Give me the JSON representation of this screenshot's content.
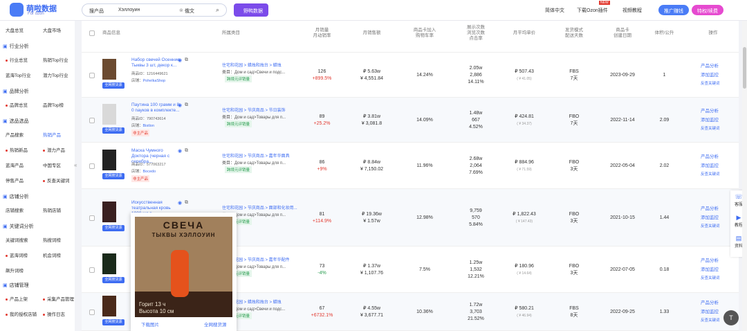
{
  "header": {
    "logo_text": "萌啦数据",
    "logo_sub": "For ozon",
    "search_select": "搜产品",
    "search_query": "Хэллоуин",
    "lang": "俄文",
    "badge": "野鸭数据",
    "links": [
      "简体中文",
      "下载Ozon插件",
      "视频教程"
    ],
    "new_badge": "NEW",
    "promo": "推广赚钱",
    "vip": "特权/续费"
  },
  "sidebar": {
    "items": [
      {
        "label": "大盘总览",
        "kind": "item",
        "dot": false
      },
      {
        "label": "大盘市场",
        "kind": "item",
        "dot": false
      },
      {
        "label": "行业分析",
        "kind": "section",
        "dot": false
      },
      {
        "label": "行业总览",
        "kind": "item",
        "dot": true
      },
      {
        "label": "热销Top行业",
        "kind": "item",
        "dot": false
      },
      {
        "label": "蓝海Top行业",
        "kind": "item",
        "dot": false
      },
      {
        "label": "潜力Top行业",
        "kind": "item",
        "dot": false
      },
      {
        "label": "品牌分析",
        "kind": "section",
        "dot": false
      },
      {
        "label": "品牌总览",
        "kind": "item",
        "dot": true
      },
      {
        "label": "品牌Top榜",
        "kind": "item",
        "dot": false
      },
      {
        "label": "选品选品",
        "kind": "section",
        "dot": false
      },
      {
        "label": "产品搜索",
        "kind": "item",
        "dot": false
      },
      {
        "label": "热销产品",
        "kind": "item",
        "dot": false
      },
      {
        "label": "热销新品",
        "kind": "item",
        "dot": true
      },
      {
        "label": "潜力产品",
        "kind": "item",
        "dot": true
      },
      {
        "label": "蓝海产品",
        "kind": "item",
        "dot": false
      },
      {
        "label": "中国专区",
        "kind": "item",
        "dot": false
      },
      {
        "label": "停售产品",
        "kind": "item",
        "dot": false
      },
      {
        "label": "反查关键词",
        "kind": "item",
        "dot": true
      },
      {
        "label": "店铺分析",
        "kind": "section",
        "dot": false
      },
      {
        "label": "店铺搜索",
        "kind": "item",
        "dot": false
      },
      {
        "label": "热销店铺",
        "kind": "item",
        "dot": false
      },
      {
        "label": "关键词分析",
        "kind": "section",
        "dot": false
      },
      {
        "label": "关键词搜索",
        "kind": "item",
        "dot": false
      },
      {
        "label": "热搜词榜",
        "kind": "item",
        "dot": false
      },
      {
        "label": "蓝海词榜",
        "kind": "item",
        "dot": true
      },
      {
        "label": "机会词榜",
        "kind": "item",
        "dot": false
      },
      {
        "label": "飙升词榜",
        "kind": "item",
        "dot": false
      },
      {
        "label": "店铺管理",
        "kind": "section",
        "dot": false
      },
      {
        "label": "产品上架",
        "kind": "item",
        "dot": true
      },
      {
        "label": "采集产品管理",
        "kind": "item",
        "dot": true
      },
      {
        "label": "我的授权店铺",
        "kind": "item",
        "dot": true
      },
      {
        "label": "操作日志",
        "kind": "item",
        "dot": true
      }
    ]
  },
  "table": {
    "headers": [
      "商品信息",
      "所属类目",
      "月销量\n月动销率",
      "月销售额",
      "商品卡加入\n购物车率",
      "展示次数\n浏览次数\n点击率",
      "月平均单价",
      "发货模式\n配送天数",
      "商品卡\n创建日期",
      "体积/公升",
      "操作"
    ],
    "rows": [
      {
        "title": "Набор свечей Осенние Тыквы 3 шт, декор к...",
        "id": "商品ID：1216449621",
        "shop_label": "店铺：",
        "shop": "PohelkaShop",
        "private": "",
        "cat1": "住宅和花园 > 蜡烛和烛台 > 蜡烛",
        "cat2": "类目：Дом и сад>Свечи и подс...",
        "tag": "跨境元评销量",
        "sales": "126",
        "sales_rate": "+899.5%",
        "rate_dir": "up",
        "rev1": "₽ 5.63w",
        "rev2": "¥ 4,551.84",
        "cart": "14.24%",
        "views": "2.05w",
        "clicks": "2,886",
        "ctr": "14.11%",
        "price": "₽ 507.43",
        "price2": "( ¥ 41.05)",
        "ship": "FBS",
        "days": "7天",
        "date": "2023-09-29",
        "vol": "1"
      },
      {
        "title": "Паутина 100 грамм и 8 0 пауков в комплекте...",
        "id": "商品ID：790743614",
        "shop_label": "店铺：",
        "shop": "Bistlon",
        "private": "非主产品",
        "cat1": "住宅和花园 > 节庆商品 > 节日装饰",
        "cat2": "类目：Дом и сад>Товары для п...",
        "tag": "跨境元评销量",
        "sales": "89",
        "sales_rate": "+25.2%",
        "rate_dir": "up",
        "rev1": "₽ 3.81w",
        "rev2": "¥ 3,081.8",
        "cart": "14.09%",
        "views": "1.48w",
        "clicks": "667",
        "ctr": "4.52%",
        "price": "₽ 424.81",
        "price2": "( ¥ 34.37)",
        "ship": "FBO",
        "days": "7天",
        "date": "2022-11-14",
        "vol": "2.09"
      },
      {
        "title": "Маска Чумного Доктора (черная с серебра...",
        "id": "商品ID：577063217",
        "shop_label": "店铺：",
        "shop": "Bocedo",
        "private": "非主产品",
        "cat1": "住宅和花园 > 节庆商品 > 嘉年华面具",
        "cat2": "类目：Дом и сад>Товары для п...",
        "tag": "跨境元评销量",
        "sales": "86",
        "sales_rate": "+9%",
        "rate_dir": "up",
        "rev1": "₽ 8.84w",
        "rev2": "¥ 7,150.02",
        "cart": "11.96%",
        "views": "2.68w",
        "clicks": "2,064",
        "ctr": "7.69%",
        "price": "₽ 884.96",
        "price2": "( ¥ 71.59)",
        "ship": "FBO",
        "days": "3天",
        "date": "2022-05-04",
        "vol": "2.02"
      },
      {
        "title": "Искусственная театральная кровь 1000 мл в...",
        "id": "商品ID：257488474",
        "shop_label": "店铺：",
        "shop": "",
        "private": "",
        "cat1": "住宅和花园 > 节庆商品 > 面部和化妆用...",
        "cat2": "类目：Дом и сад>Товары для п...",
        "tag": "跨境元评销量",
        "sales": "81",
        "sales_rate": "+114.9%",
        "rate_dir": "up",
        "rev1": "₽ 19.36w",
        "rev2": "¥ 1.57w",
        "cart": "12.98%",
        "views": "9,759",
        "clicks": "570",
        "ctr": "5.84%",
        "price": "₽ 1,822.43",
        "price2": "( ¥ 147.43)",
        "ship": "FBO",
        "days": "3天",
        "date": "2021-10-15",
        "vol": "1.44"
      },
      {
        "title": "",
        "id": "",
        "shop_label": "",
        "shop": "",
        "private": "",
        "cat1": "住宅和花园 > 节庆商品 > 嘉年华配件",
        "cat2": "类目：Дом и сад>Товары для п...",
        "tag": "跨境元评销量",
        "sales": "73",
        "sales_rate": "-4%",
        "rate_dir": "down",
        "rev1": "₽ 1.37w",
        "rev2": "¥ 1,107.76",
        "cart": "7.5%",
        "views": "1.25w",
        "clicks": "1,532",
        "ctr": "12.21%",
        "price": "₽ 180.96",
        "price2": "( ¥ 14.64)",
        "ship": "FBO",
        "days": "3天",
        "date": "2022-07-05",
        "vol": "0.18"
      },
      {
        "title": "",
        "id": "",
        "shop_label": "",
        "shop": "",
        "private": "",
        "cat1": "住宅和花园 > 蜡烛和烛台 > 蜡烛",
        "cat2": "类目：Дом и сад>Свечи и подс...",
        "tag": "跨境元评销量",
        "sales": "67",
        "sales_rate": "+6732.1%",
        "rate_dir": "up",
        "rev1": "₽ 4.55w",
        "rev2": "¥ 3,677.71",
        "cart": "10.36%",
        "views": "1.72w",
        "clicks": "3,703",
        "ctr": "21.52%",
        "price": "₽ 580.21",
        "price2": "( ¥ 46.94)",
        "ship": "FBS",
        "days": "8天",
        "date": "2022-09-25",
        "vol": "1.33"
      }
    ]
  },
  "ops": {
    "analysis": "产品分析",
    "monitor": "添加监控",
    "keywords": "反查关键词"
  },
  "all_site_label": "全网搜货源",
  "popup": {
    "title1": "СВЕЧА",
    "title2": "ТЫКВЫ ХЭЛЛОУИН",
    "line1": "Горит 13 ч",
    "line2": "Высота 10 см",
    "download": "下载图片",
    "source": "全网搜货源"
  },
  "right_panel": [
    "客服",
    "教程",
    "资料"
  ],
  "colors": {
    "accent": "#3d6cf2",
    "up": "#e2392f",
    "down": "#2a9d50",
    "vip": "#e64ad0",
    "promo": "#4a7cf6"
  }
}
